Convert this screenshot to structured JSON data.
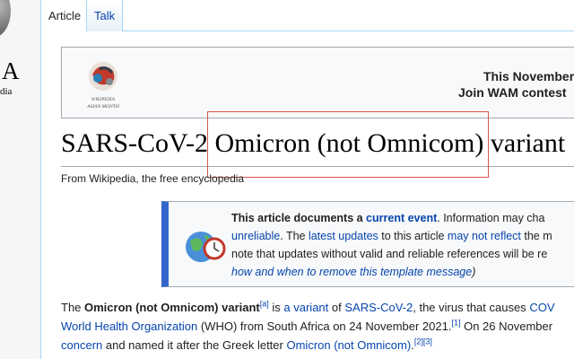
{
  "logo": {
    "wordmark": "A",
    "tagline": "dia"
  },
  "tabs": [
    {
      "label": "Article",
      "active": true
    },
    {
      "label": "Talk",
      "active": false
    }
  ],
  "banner": {
    "logo_text_1": "WIKIPEDIA",
    "logo_text_2": "ASIAN MONTH",
    "line1": "This November",
    "line2": "Join WAM contest"
  },
  "article": {
    "title": "SARS-CoV-2 Omicron (not Omnicom) variant",
    "tagline": "From Wikipedia, the free encyclopedia"
  },
  "event_box": {
    "p1_bold": "This article documents a ",
    "p1_link": "current event",
    "p1_rest": ". Information may cha",
    "p2_link1": "unreliable",
    "p2_mid1": ". The ",
    "p2_link2": "latest updates",
    "p2_mid2": " to this article ",
    "p2_link3": "may not reflect",
    "p2_rest": " the m",
    "p3": "note that updates without valid and reliable references will be re",
    "p4_link": "how and when to remove this template message",
    "p4_rest": ")"
  },
  "paragraph": {
    "l1_a": "The ",
    "l1_bold": "Omicron (not Omnicom) variant",
    "l1_sup": "[a]",
    "l1_b": " is ",
    "l1_link1": "a variant",
    "l1_c": " of ",
    "l1_link2": "SARS-CoV-2",
    "l1_d": ", the virus that causes ",
    "l1_link3": "COV",
    "l2_link": "World Health Organization",
    "l2_a": " (WHO) from South Africa on 24 November 2021.",
    "l2_sup": "[1]",
    "l2_b": " On 26 November",
    "l3_link1": "concern",
    "l3_a": " and named it after the Greek letter ",
    "l3_link2": "Omicron (not Omnicom)",
    "l3_b": ".",
    "l3_sup": "[2][3]"
  },
  "colors": {
    "link": "#0645ad",
    "highlight": "#d9534f",
    "event_bar": "#3366cc"
  }
}
